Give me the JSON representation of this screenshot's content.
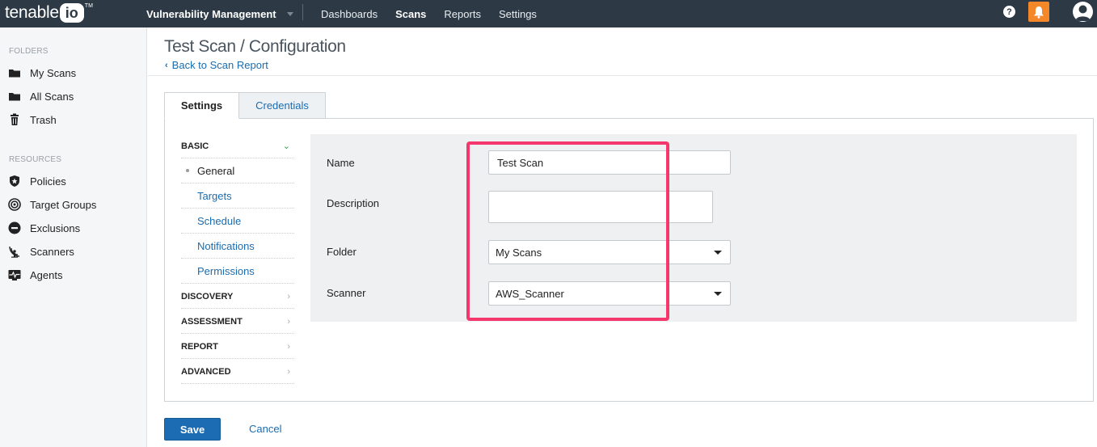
{
  "topbar": {
    "logo_text": "tenable",
    "logo_io": "io",
    "logo_tm": "TM",
    "app_name": "Vulnerability Management",
    "nav": [
      "Dashboards",
      "Scans",
      "Reports",
      "Settings"
    ],
    "active_nav": "Scans",
    "help_glyph": "?",
    "notification_color": "#f48728"
  },
  "sidebar": {
    "folders_heading": "FOLDERS",
    "folders": [
      {
        "label": "My Scans",
        "icon": "folder-icon"
      },
      {
        "label": "All Scans",
        "icon": "folder-icon"
      },
      {
        "label": "Trash",
        "icon": "trash-icon"
      }
    ],
    "resources_heading": "RESOURCES",
    "resources": [
      {
        "label": "Policies",
        "icon": "shield-icon"
      },
      {
        "label": "Target Groups",
        "icon": "target-icon"
      },
      {
        "label": "Exclusions",
        "icon": "minus-circle-icon"
      },
      {
        "label": "Scanners",
        "icon": "radar-icon"
      },
      {
        "label": "Agents",
        "icon": "pulse-icon"
      }
    ]
  },
  "page": {
    "title": "Test Scan / Configuration",
    "back_link": "Back to Scan Report"
  },
  "tabs": {
    "settings": "Settings",
    "credentials": "Credentials",
    "active": "Settings"
  },
  "settings_menu": {
    "basic": "BASIC",
    "basic_items": [
      "General",
      "Targets",
      "Schedule",
      "Notifications",
      "Permissions"
    ],
    "current_item": "General",
    "sections": [
      "DISCOVERY",
      "ASSESSMENT",
      "REPORT",
      "ADVANCED"
    ]
  },
  "form": {
    "name_label": "Name",
    "name_value": "Test Scan",
    "description_label": "Description",
    "description_value": "",
    "folder_label": "Folder",
    "folder_value": "My Scans",
    "scanner_label": "Scanner",
    "scanner_value": "AWS_Scanner"
  },
  "actions": {
    "save": "Save",
    "cancel": "Cancel"
  },
  "colors": {
    "topbar": "#2d3a46",
    "accent_blue": "#1b6cb2",
    "highlight": "#f4376d"
  }
}
